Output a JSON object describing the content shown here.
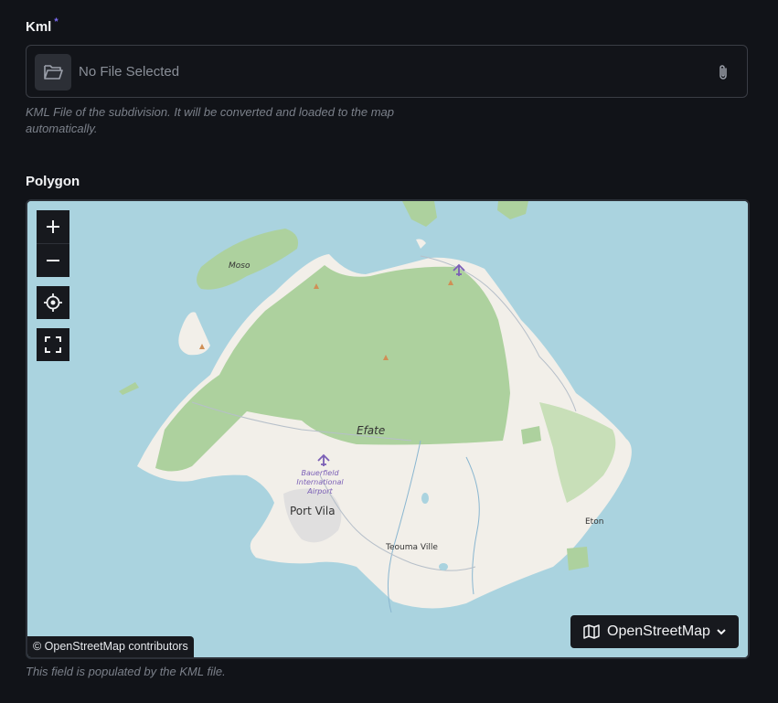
{
  "kml": {
    "label": "Kml",
    "required_mark": "*",
    "placeholder": "No File Selected",
    "hint": "KML File of the subdivision. It will be converted and loaded to the map automatically."
  },
  "polygon": {
    "label": "Polygon",
    "hint": "This field is populated by the KML file."
  },
  "map": {
    "attribution": "© OpenStreetMap contributors",
    "layer_label": "OpenStreetMap",
    "places": {
      "island": "Efate",
      "moso": "Moso",
      "airport": "Bauerfield International Airport",
      "capital": "Port Vila",
      "town1": "Teouma Ville",
      "town2": "Eton"
    },
    "controls": [
      "zoom-in",
      "zoom-out",
      "locate",
      "fullscreen"
    ],
    "colors": {
      "water": "#aad3df",
      "land": "#f2efe9",
      "forest": "#add19e"
    }
  }
}
